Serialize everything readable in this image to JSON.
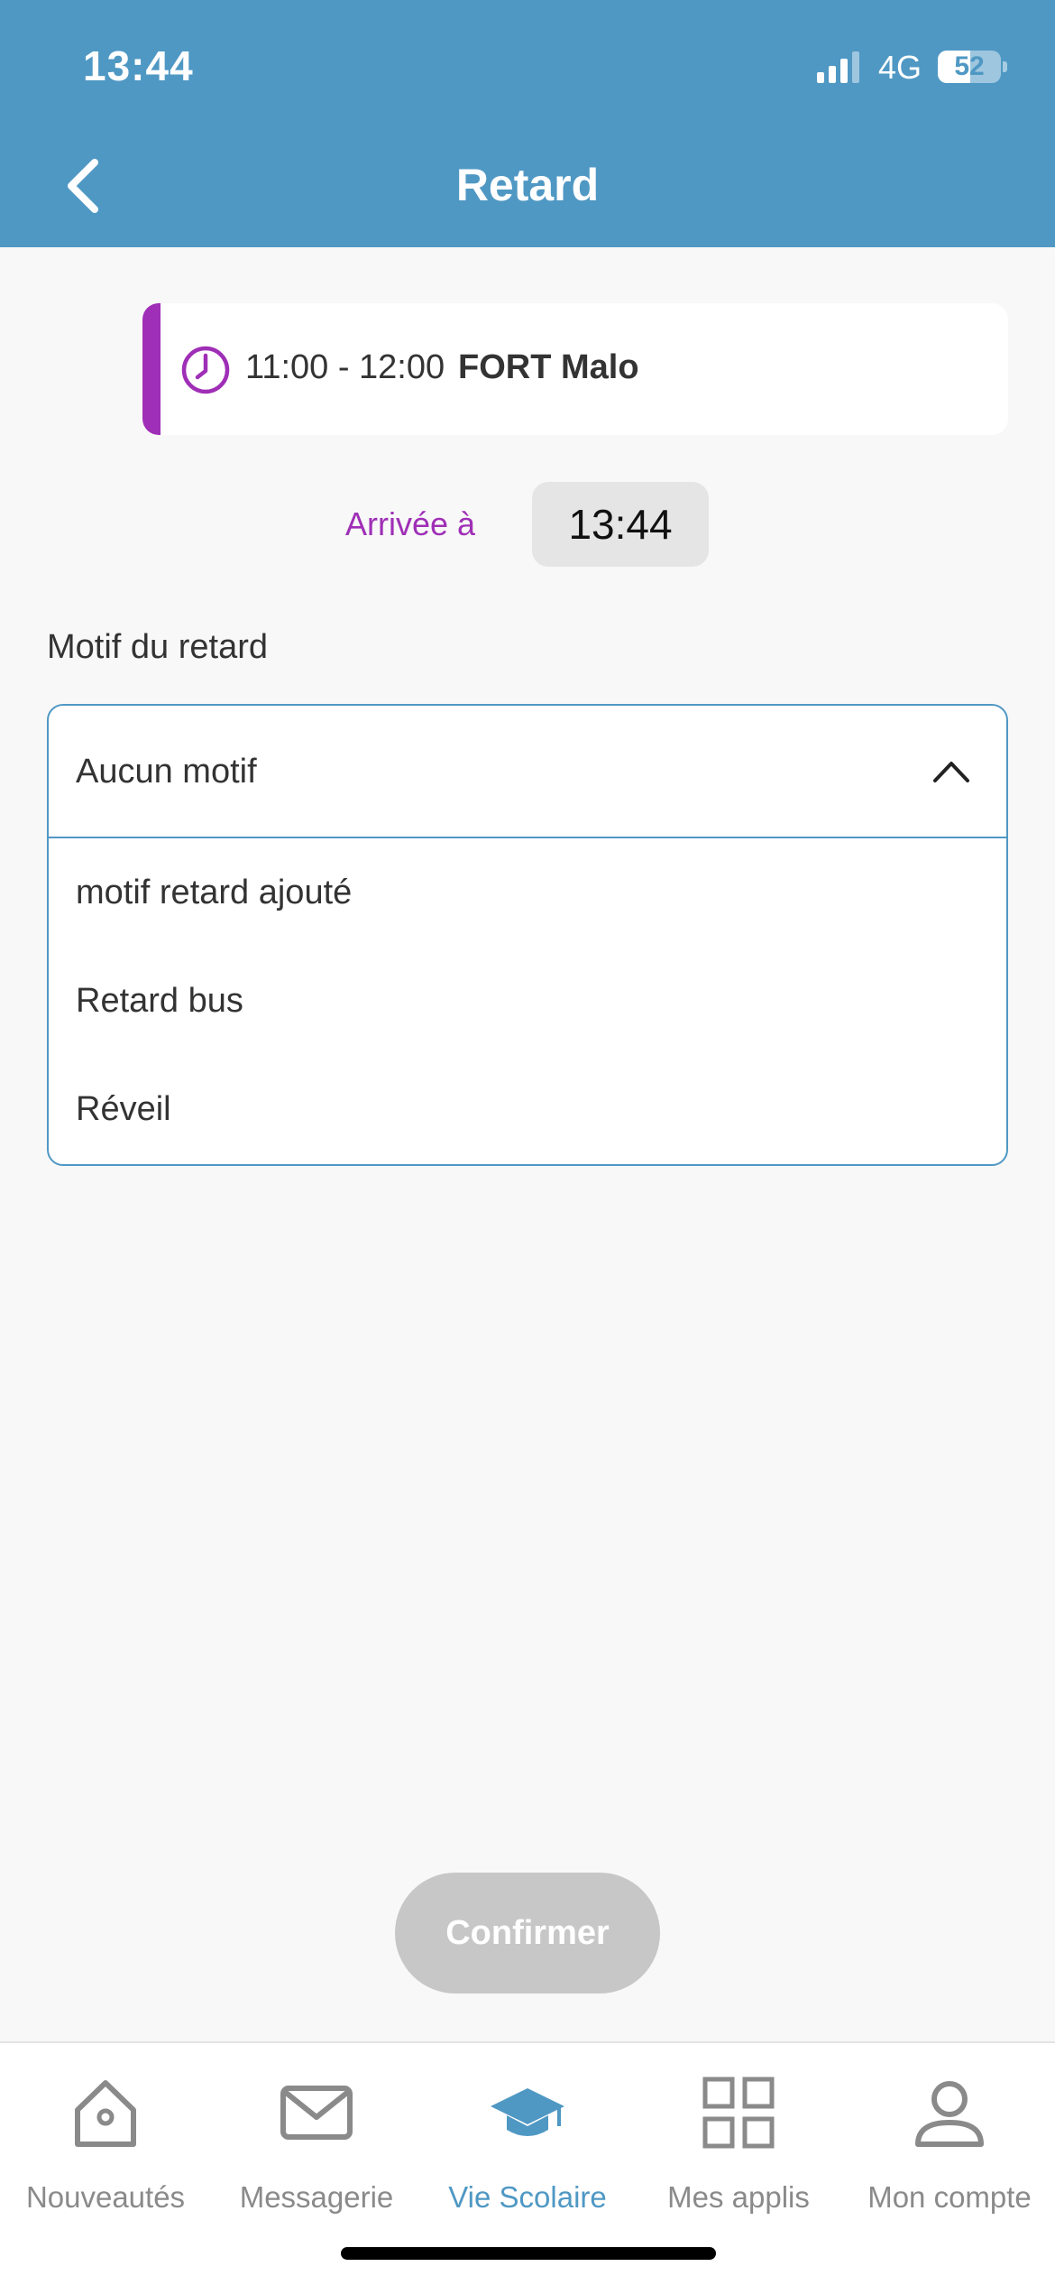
{
  "status_bar": {
    "time": "13:44",
    "network": "4G",
    "battery": "52"
  },
  "header": {
    "title": "Retard"
  },
  "course": {
    "time_range": "11:00 - 12:00",
    "name": "FORT Malo",
    "accent_color": "#9f2fb6"
  },
  "arrival": {
    "label": "Arrivée à",
    "time": "13:44"
  },
  "reason": {
    "label": "Motif du retard",
    "selected": "Aucun motif",
    "options": [
      "motif retard ajouté",
      "Retard bus",
      "Réveil"
    ]
  },
  "confirm": {
    "label": "Confirmer"
  },
  "tabbar": {
    "active_color": "#4f98c4",
    "tabs": [
      {
        "label": "Nouveautés",
        "icon": "home-icon"
      },
      {
        "label": "Messagerie",
        "icon": "mail-icon"
      },
      {
        "label": "Vie Scolaire",
        "icon": "graduation-cap-icon",
        "active": true
      },
      {
        "label": "Mes applis",
        "icon": "apps-grid-icon"
      },
      {
        "label": "Mon compte",
        "icon": "user-icon"
      }
    ]
  }
}
